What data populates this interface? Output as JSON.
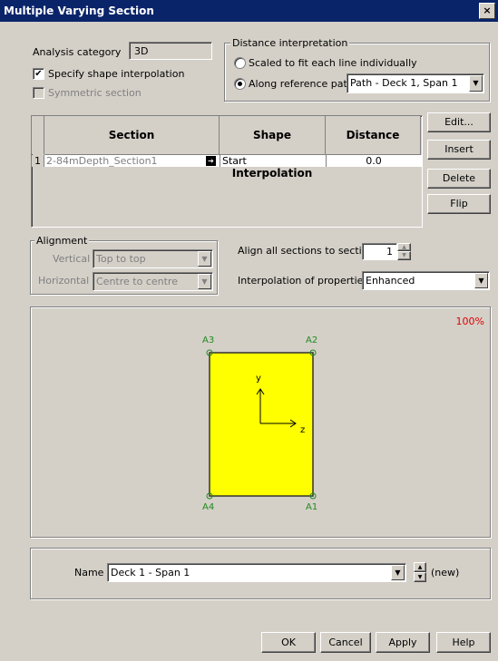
{
  "window": {
    "title": "Multiple Varying Section",
    "close_glyph": "×"
  },
  "analysis": {
    "label": "Analysis category",
    "value": "3D"
  },
  "shape_interp": {
    "label": "Specify shape interpolation",
    "checked": true
  },
  "symmetric": {
    "label": "Symmetric section",
    "checked": false
  },
  "distance": {
    "group_title": "Distance interpretation",
    "opt1": "Scaled to fit each line individually",
    "opt2": "Along reference path",
    "path_value": "Path - Deck 1, Span 1"
  },
  "grid": {
    "headers": [
      "Section",
      "Shape Interpolation",
      "Distance"
    ],
    "rows": [
      {
        "num": "1",
        "section": "2-84mDepth_Section1",
        "interp": "Start",
        "distance": "0.0"
      }
    ]
  },
  "buttons": {
    "edit": "Edit...",
    "insert": "Insert",
    "delete": "Delete",
    "flip": "Flip"
  },
  "alignment": {
    "group_title": "Alignment",
    "vertical_label": "Vertical",
    "vertical_value": "Top to top",
    "horizontal_label": "Horizontal",
    "horizontal_value": "Centre to centre"
  },
  "align_all": {
    "label": "Align all sections to section",
    "value": "1"
  },
  "interp_props": {
    "label": "Interpolation of properties",
    "value": "Enhanced"
  },
  "preview": {
    "zoom": "100%",
    "points": [
      "A3",
      "A2",
      "A4",
      "A1"
    ],
    "axis_y": "y",
    "axis_z": "z",
    "fill_color": "#ffff00"
  },
  "name": {
    "label": "Name",
    "value": "Deck 1 - Span 1",
    "status": "(new)"
  },
  "footer": {
    "ok": "OK",
    "cancel": "Cancel",
    "apply": "Apply",
    "help": "Help"
  }
}
